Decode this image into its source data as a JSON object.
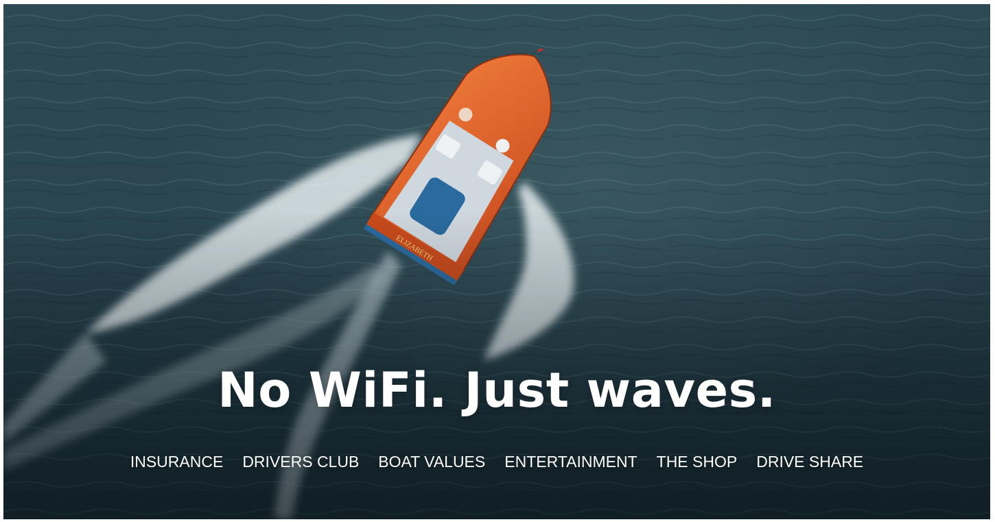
{
  "hero": {
    "headline": "No WiFi. Just waves.",
    "boat_name": "ELIZABETH",
    "colors": {
      "water": "#2a4550",
      "boat_hull": "#e8662c",
      "text": "#ffffff"
    }
  },
  "nav": {
    "items": [
      {
        "label": "INSURANCE"
      },
      {
        "label": "DRIVERS CLUB"
      },
      {
        "label": "BOAT VALUES"
      },
      {
        "label": "ENTERTAINMENT"
      },
      {
        "label": "THE SHOP"
      },
      {
        "label": "DRIVE SHARE"
      }
    ]
  }
}
